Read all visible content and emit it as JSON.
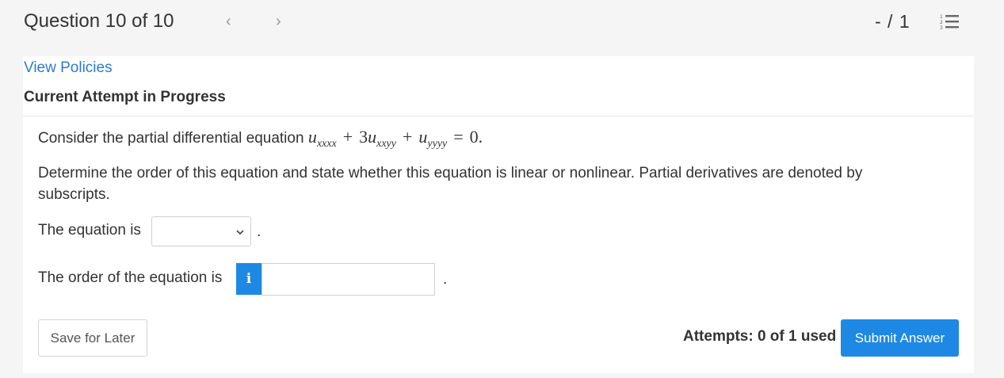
{
  "header": {
    "question_title": "Question 10 of 10",
    "prev_icon": "‹",
    "next_icon": "›",
    "score": "- / 1",
    "list_icon": "numbered-list-icon"
  },
  "links": {
    "view_policies": "View Policies"
  },
  "attempt": {
    "heading": "Current Attempt in Progress"
  },
  "question": {
    "pde_intro": "Consider the partial differential equation",
    "equation": {
      "t1_var": "u",
      "t1_sub": "xxxx",
      "op1": "+",
      "t2_coef": "3",
      "t2_var": "u",
      "t2_sub": "xxyy",
      "op2": "+",
      "t3_var": "u",
      "t3_sub": "yyyy",
      "eq": "=",
      "rhs": "0."
    },
    "instructions": "Determine the order of this equation and state whether this equation is linear or nonlinear. Partial derivatives are denoted by subscripts.",
    "equation_is_label": "The equation is",
    "equation_is_value": "",
    "period": ".",
    "order_label": "The order of the equation is",
    "info_icon": "i",
    "order_value": ""
  },
  "footer": {
    "save_label": "Save for Later",
    "attempts_text": "Attempts: 0 of 1 used",
    "submit_label": "Submit Answer"
  },
  "colors": {
    "accent": "#1e88e5",
    "link": "#2b7bd0",
    "background": "#f5f5f5"
  }
}
